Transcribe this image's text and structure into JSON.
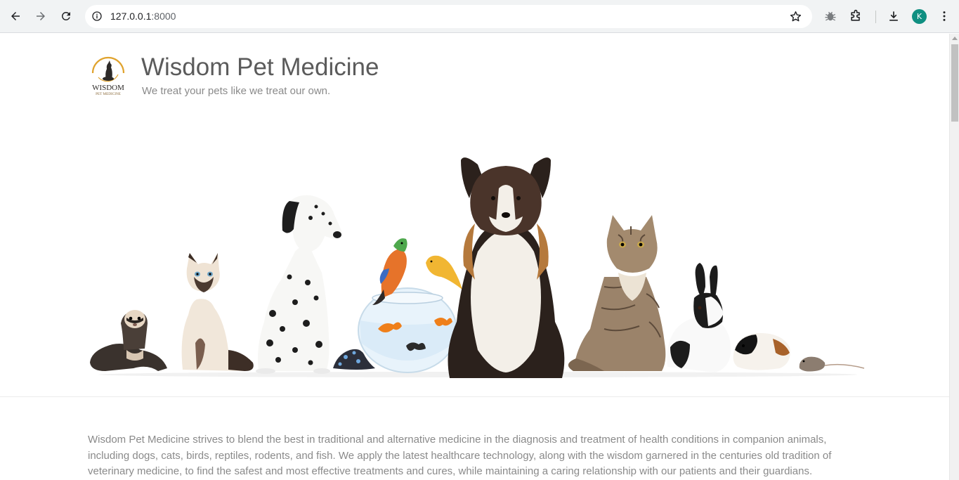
{
  "browser": {
    "url_host": "127.0.0.1",
    "url_port": ":8000",
    "profile_initial": "K",
    "icons": {
      "back": "arrow-left-icon",
      "forward": "arrow-right-icon",
      "reload": "reload-icon",
      "site_info": "info-icon",
      "bookmark": "star-icon",
      "bug": "bug-icon",
      "extensions": "puzzle-icon",
      "downloads": "download-icon",
      "menu": "kebab-menu-icon"
    }
  },
  "header": {
    "logo_text": "WISDOM",
    "logo_subtext": "PET MEDICINE",
    "title": "Wisdom Pet Medicine",
    "tagline": "We treat your pets like we treat our own."
  },
  "hero": {
    "animals": [
      "ferret",
      "siamese-cat",
      "dalmatian",
      "poison-dart-frog",
      "fishbowl",
      "parrot",
      "canary",
      "goldfish",
      "collie",
      "maine-coon-cat",
      "rabbit",
      "guinea-pig",
      "mouse"
    ]
  },
  "content": {
    "intro": "Wisdom Pet Medicine strives to blend the best in traditional and alternative medicine in the diagnosis and treatment of health conditions in companion animals, including dogs, cats, birds, reptiles, rodents, and fish. We apply the latest healthcare technology, along with the wisdom garnered in the centuries old tradition of veterinary medicine, to find the safest and most effective treatments and cures, while maintaining a caring relationship with our patients and their guardians."
  },
  "colors": {
    "chrome_bg": "#f1f3f4",
    "title_text": "#5b5b5b",
    "body_text": "#8a8a8a",
    "logo_gold": "#e0a32e",
    "avatar": "#0f8f81"
  }
}
